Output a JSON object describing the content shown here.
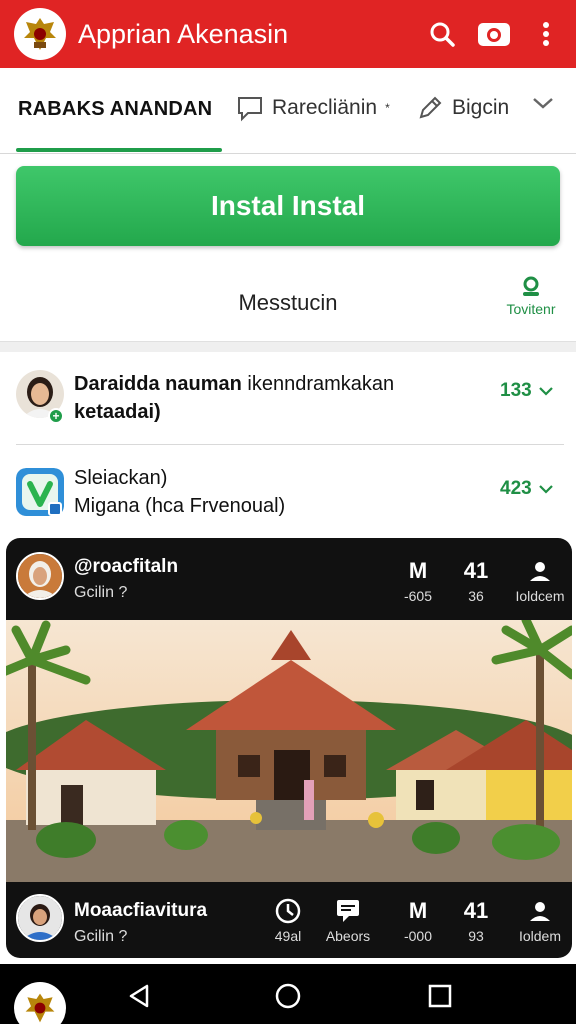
{
  "app": {
    "title": "Apprian Akenasin"
  },
  "tabs": {
    "active": "RABAKS ANANDAN",
    "tab2": "Rarecliänin",
    "tab2_mark": "*",
    "tab3": "Bigcin"
  },
  "install": {
    "label": "Instal Instal"
  },
  "message_row": {
    "label": "Messtucin",
    "side_label": "Tovitenr"
  },
  "list": [
    {
      "title_bold": "Daraidda nauman",
      "title_rest": "ikenndramkakan",
      "subtitle": "ketaadai)",
      "count": "133"
    },
    {
      "title": "Sleiackan)",
      "subtitle": "Migana  (hca Frvenoual)",
      "count": "423"
    }
  ],
  "card": {
    "header": {
      "user": "@roacfitaln",
      "sub": "Gcilin ?",
      "stats": [
        {
          "icon": "M",
          "value": "-605"
        },
        {
          "icon": "41",
          "value": "36"
        },
        {
          "icon": "person",
          "value": "Ioldcem"
        }
      ]
    },
    "footer": {
      "user": "Moaacfiavitura",
      "sub": "Gcilin ?",
      "stats": [
        {
          "icon": "clock",
          "value": "49al"
        },
        {
          "icon": "chat",
          "value": "Abeors"
        },
        {
          "icon": "M",
          "value": "-000"
        },
        {
          "icon": "41",
          "value": "93"
        },
        {
          "icon": "person",
          "value": "Ioldem"
        }
      ]
    }
  },
  "colors": {
    "brand_red": "#e02424",
    "accent_green": "#1f9d4a"
  }
}
